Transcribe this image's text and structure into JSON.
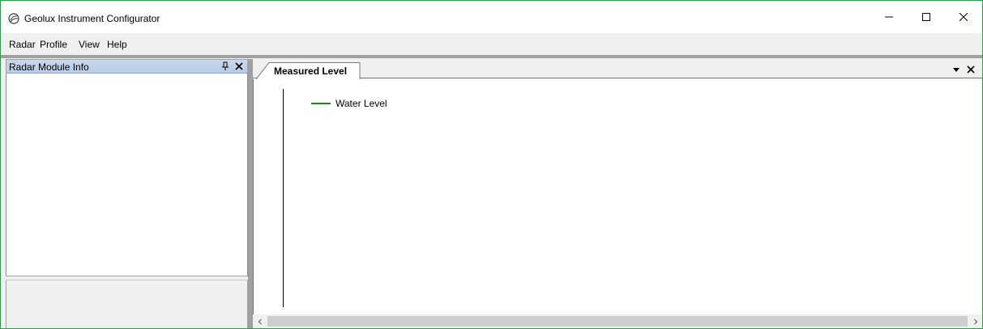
{
  "window": {
    "title": "Geolux Instrument Configurator",
    "icons": {
      "app": "geolux-logo-icon",
      "minimize": "minimize-icon",
      "maximize": "maximize-icon",
      "close": "close-icon"
    }
  },
  "menu": {
    "items": [
      "Radar",
      "Profile",
      "View",
      "Help"
    ]
  },
  "left_panel": {
    "caption": "Radar Module Info",
    "icons": {
      "pin": "pin-icon",
      "close": "close-icon"
    },
    "header_color": "#bfd2e8"
  },
  "document": {
    "tabs": [
      {
        "label": "Measured Level",
        "active": true
      }
    ],
    "icons": {
      "menu": "dropdown-arrow-icon",
      "close": "close-icon"
    }
  },
  "chart": {
    "legend": [
      {
        "name": "Water Level",
        "color": "#1e8a1e"
      }
    ]
  },
  "scrollbar": {
    "icons": {
      "left": "scroll-left-icon",
      "right": "scroll-right-icon"
    }
  },
  "colors": {
    "window_border": "#2e9b4b",
    "chrome": "#f0f0f0",
    "series_color": "#1e8a1e"
  }
}
